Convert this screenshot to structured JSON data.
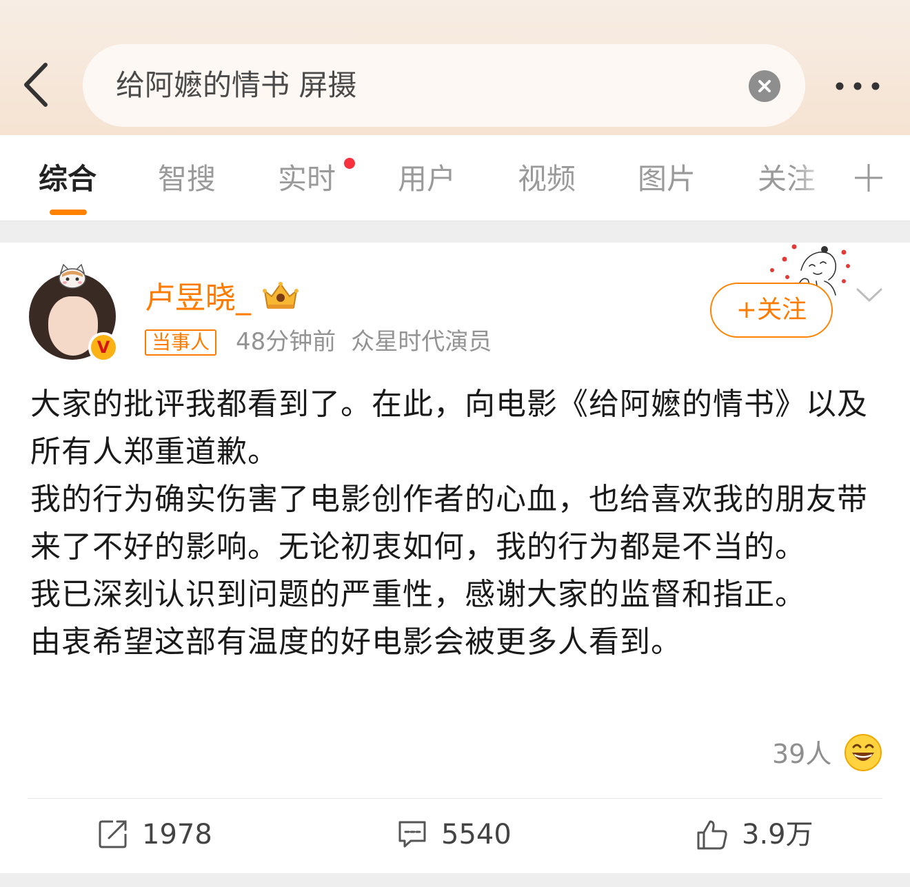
{
  "search": {
    "query": "给阿嬷的情书 屏摄"
  },
  "tabs": [
    {
      "label": "综合",
      "active": true
    },
    {
      "label": "智搜",
      "active": false
    },
    {
      "label": "实时",
      "active": false,
      "has_dot": true
    },
    {
      "label": "用户",
      "active": false
    },
    {
      "label": "视频",
      "active": false
    },
    {
      "label": "图片",
      "active": false
    },
    {
      "label": "关注",
      "active": false
    }
  ],
  "post": {
    "author": {
      "name": "卢昱晓_",
      "tag": "当事人",
      "verified": true,
      "verified_badge": "V"
    },
    "time": "48分钟前",
    "source": "众星时代演员",
    "follow_label": "+关注",
    "body": [
      "大家的批评我都看到了。在此，向电影《给阿嬷的情书》以及所有人郑重道歉。",
      "我的行为确实伤害了电影创作者的心血，也给喜欢我的朋友带来了不好的影响。无论初衷如何，我的行为都是不当的。",
      "我已深刻认识到问题的严重性，感谢大家的监督和指正。",
      "由衷希望这部有温度的好电影会被更多人看到。"
    ],
    "reaction": {
      "count_label": "39人",
      "emoji": "laughing-face-icon"
    },
    "actions": {
      "repost": "1978",
      "comments": "5540",
      "likes": "3.9万"
    }
  },
  "colors": {
    "accent": "#ff8200",
    "username": "#ff7b00",
    "header_bg": "#f6e3d2",
    "tab_dot": "#f6323f"
  }
}
